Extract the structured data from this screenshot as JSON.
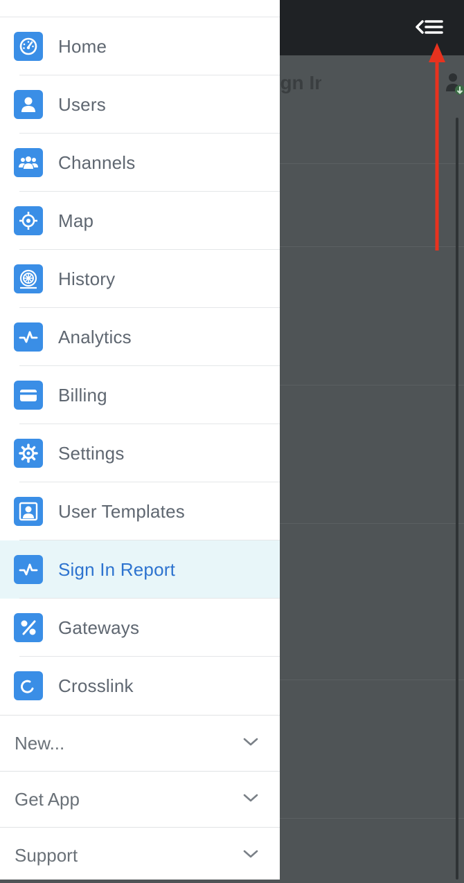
{
  "background": {
    "header_text": "Sign In Report"
  },
  "menu": {
    "items": [
      {
        "label": "Home",
        "icon": "dashboard-icon"
      },
      {
        "label": "Users",
        "icon": "user-icon"
      },
      {
        "label": "Channels",
        "icon": "group-icon"
      },
      {
        "label": "Map",
        "icon": "crosshair-icon"
      },
      {
        "label": "History",
        "icon": "history-icon"
      },
      {
        "label": "Analytics",
        "icon": "pulse-icon"
      },
      {
        "label": "Billing",
        "icon": "credit-card-icon"
      },
      {
        "label": "Settings",
        "icon": "gear-icon"
      },
      {
        "label": "User Templates",
        "icon": "user-template-icon"
      },
      {
        "label": "Sign In Report",
        "icon": "pulse-icon",
        "active": true
      },
      {
        "label": "Gateways",
        "icon": "gateway-icon"
      },
      {
        "label": "Crosslink",
        "icon": "crosslink-icon"
      }
    ],
    "sections": [
      {
        "label": "New..."
      },
      {
        "label": "Get App"
      },
      {
        "label": "Support"
      }
    ]
  },
  "colors": {
    "icon_bg": "#3a8ee6",
    "active_bg": "#e8f6f9",
    "active_text": "#2d73cf",
    "arrow": "#e8321e",
    "overlay": "#4f5456"
  }
}
